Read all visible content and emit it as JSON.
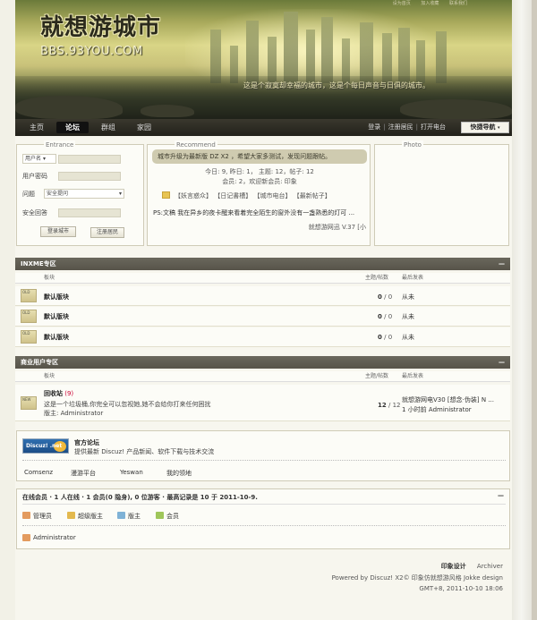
{
  "header": {
    "logo_cn": "就想游城市",
    "logo_en": "BBS.93YOU.COM",
    "slogan": "这是个寂寞却幸福的城市，这是个每日声音与日俱的城市。",
    "top_links": [
      "设为首页",
      "加入收藏",
      "联系我们"
    ]
  },
  "nav": {
    "items": [
      "主页",
      "论坛",
      "群组",
      "家园"
    ],
    "active_index": 1,
    "right_links": [
      "登录",
      "注册居民",
      "打开电台"
    ],
    "quick_nav": "快捷导航"
  },
  "entrance": {
    "title": "Entrance",
    "username_select": "用户名",
    "password_label": "用户密码",
    "question_label": "问题",
    "question_select": "安全提问",
    "answer_label": "安全回答",
    "login_button": "登录城市",
    "register_button": "注册居民"
  },
  "recommend": {
    "title": "Recommend",
    "announcement": "城市升级为最新版 DZ X2 ，希望大家多测试，发现问题跟帖。",
    "stats_line": "今日: 9, 昨日: 1，  主题: 12，帖子: 12",
    "members_line": "会员: 2，欢迎新会员: 印象",
    "tabs": [
      "【妖言惑众】",
      "【日记書槽】",
      "【城市电台】",
      "【最新帖子】"
    ],
    "post_preview": "PS:文稿  我在异乡的夜卡醒来看着完全陌生的窗外没有一盏熟悉的灯可 ...",
    "version": "就想游网迅  V.37 [小"
  },
  "photo": {
    "title": "Photo"
  },
  "section1": {
    "title": "INXME专区",
    "collapse": "—",
    "col_board": "板块",
    "col_count": "主题/帖数",
    "col_last": "最后发表",
    "rows": [
      {
        "name": "默认版块",
        "topics": "0",
        "posts": "0",
        "last": "从未"
      },
      {
        "name": "默认版块",
        "topics": "0",
        "posts": "0",
        "last": "从未"
      },
      {
        "name": "默认版块",
        "topics": "0",
        "posts": "0",
        "last": "从未"
      }
    ],
    "icon_text": "OLD"
  },
  "section2": {
    "title": "商业用户专区",
    "collapse": "—",
    "col_board": "板块",
    "col_count": "主题/帖数",
    "col_last": "最后发表",
    "forum_name": "回收站",
    "forum_today": "(9)",
    "forum_desc": "这是一个垃圾桶,你完全可以忽视她,她不会给你打来任何困扰",
    "forum_mod": "版主: Administrator",
    "topics": "12",
    "posts": "12",
    "last_title": "就想游网电V30 [想念·伪装] N ...",
    "last_time": "1 小时前  Administrator",
    "icon_text": "NEW"
  },
  "links": {
    "official_title": "官方论坛",
    "official_desc": "提供最新 Discuz! 产品新闻、软件下载与技术交流",
    "logo_text": "Discuz!  .net",
    "items": [
      "Comsenz",
      "漫游平台",
      "Yeswan",
      "我的领地"
    ]
  },
  "online": {
    "title": "在线会员 · 1 人在线 · 1 会员(0 隐身), 0 位游客 · 最高记录是 10 于 2011-10-9.",
    "collapse": "—",
    "legend": [
      "管理员",
      "超级版主",
      "版主",
      "会员"
    ],
    "legend_colors": [
      "#e39b5e",
      "#e3b94e",
      "#7fb2d6",
      "#9fc65a"
    ],
    "user": "Administrator"
  },
  "footer": {
    "links": [
      "印象设计",
      "Archiver"
    ],
    "powered": "Powered by Discuz! X2© 印象仿就想游风格 Jokke design",
    "time": "GMT+8, 2011-10-10 18:06"
  }
}
